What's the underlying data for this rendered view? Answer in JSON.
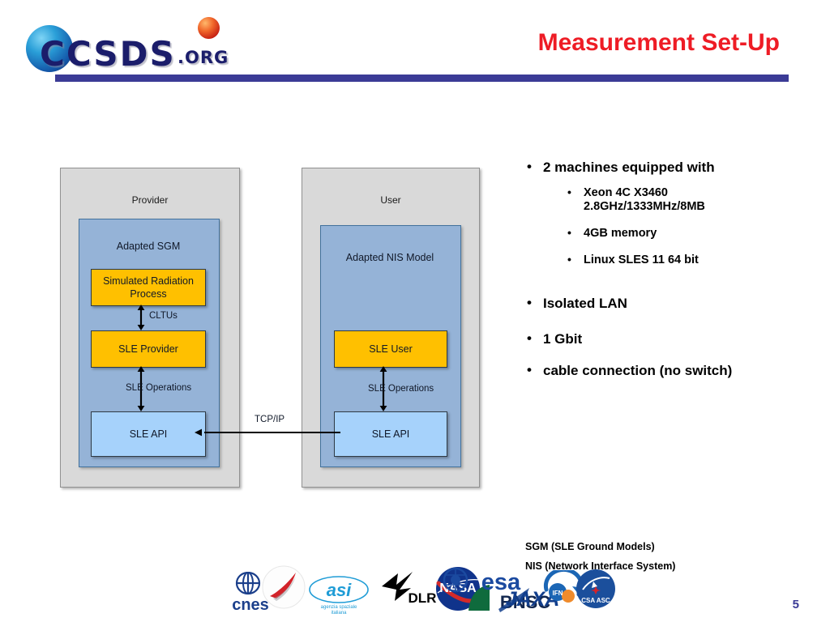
{
  "header": {
    "logo": {
      "wordmark": "CCSDS",
      "tld": ".ORG"
    },
    "title": "Measurement Set-Up",
    "accent_color": "#3b3b96",
    "title_color": "#ee1c25"
  },
  "diagram": {
    "provider": {
      "label": "Provider",
      "panel_label": "Adapted SGM",
      "nodes": [
        {
          "label": "Simulated Radiation Process",
          "color": "#ffc000"
        },
        {
          "label": "SLE Provider",
          "color": "#ffc000"
        },
        {
          "label": "SLE API",
          "color": "#a6d2fb"
        }
      ],
      "connector_labels": [
        "CLTUs",
        "SLE Operations"
      ]
    },
    "user": {
      "label": "User",
      "panel_label": "Adapted NIS Model",
      "nodes": [
        {
          "label": "SLE User",
          "color": "#ffc000"
        },
        {
          "label": "SLE API",
          "color": "#a6d2fb"
        }
      ],
      "connector_labels": [
        "SLE Operations"
      ]
    },
    "link_label": "TCP/IP",
    "colors": {
      "outer": "#d9d9d9",
      "panel": "#95b3d7",
      "yellow": "#ffc000",
      "lightblue": "#a6d2fb"
    }
  },
  "bullets": {
    "items": [
      {
        "level": 1,
        "text": "2 machines equipped with"
      },
      {
        "level": 2,
        "text": "Xeon 4C X3460 2.8GHz/1333MHz/8MB"
      },
      {
        "level": 2,
        "text": "4GB memory"
      },
      {
        "level": 2,
        "text": "Linux SLES 11 64 bit"
      },
      {
        "level": 1,
        "text": "Isolated LAN"
      },
      {
        "level": 1,
        "text": "1 Gbit"
      },
      {
        "level": 1,
        "text": "cable connection (no switch)"
      }
    ],
    "machines_heading": "2 machines equipped with",
    "cpu_line1": "Xeon 4C X3460",
    "cpu_line2": "2.8GHz/1333MHz/8MB",
    "memory": "4GB memory",
    "os": "Linux SLES 11 64 bit",
    "lan": "Isolated LAN",
    "speed": "1 Gbit",
    "cabling": "cable connection (no switch)"
  },
  "footnotes": {
    "sgm": "SGM (SLE Ground Models)",
    "nis": "NIS (Network Interface System)"
  },
  "agencies": [
    {
      "name": "cnes",
      "label": "cnes"
    },
    {
      "name": "roscosmos",
      "label": ""
    },
    {
      "name": "asi",
      "label": "agenzia spaziale italiana"
    },
    {
      "name": "dlr",
      "label": "DLR"
    },
    {
      "name": "nasa",
      "label": "NASA"
    },
    {
      "name": "bnsc",
      "label": "BNSC"
    },
    {
      "name": "esa",
      "label": "esa"
    },
    {
      "name": "jaxa",
      "label": "JAXA"
    },
    {
      "name": "ifn",
      "label": ""
    },
    {
      "name": "csa-asc",
      "label": "CSA ASC"
    }
  ],
  "page_number": "5"
}
